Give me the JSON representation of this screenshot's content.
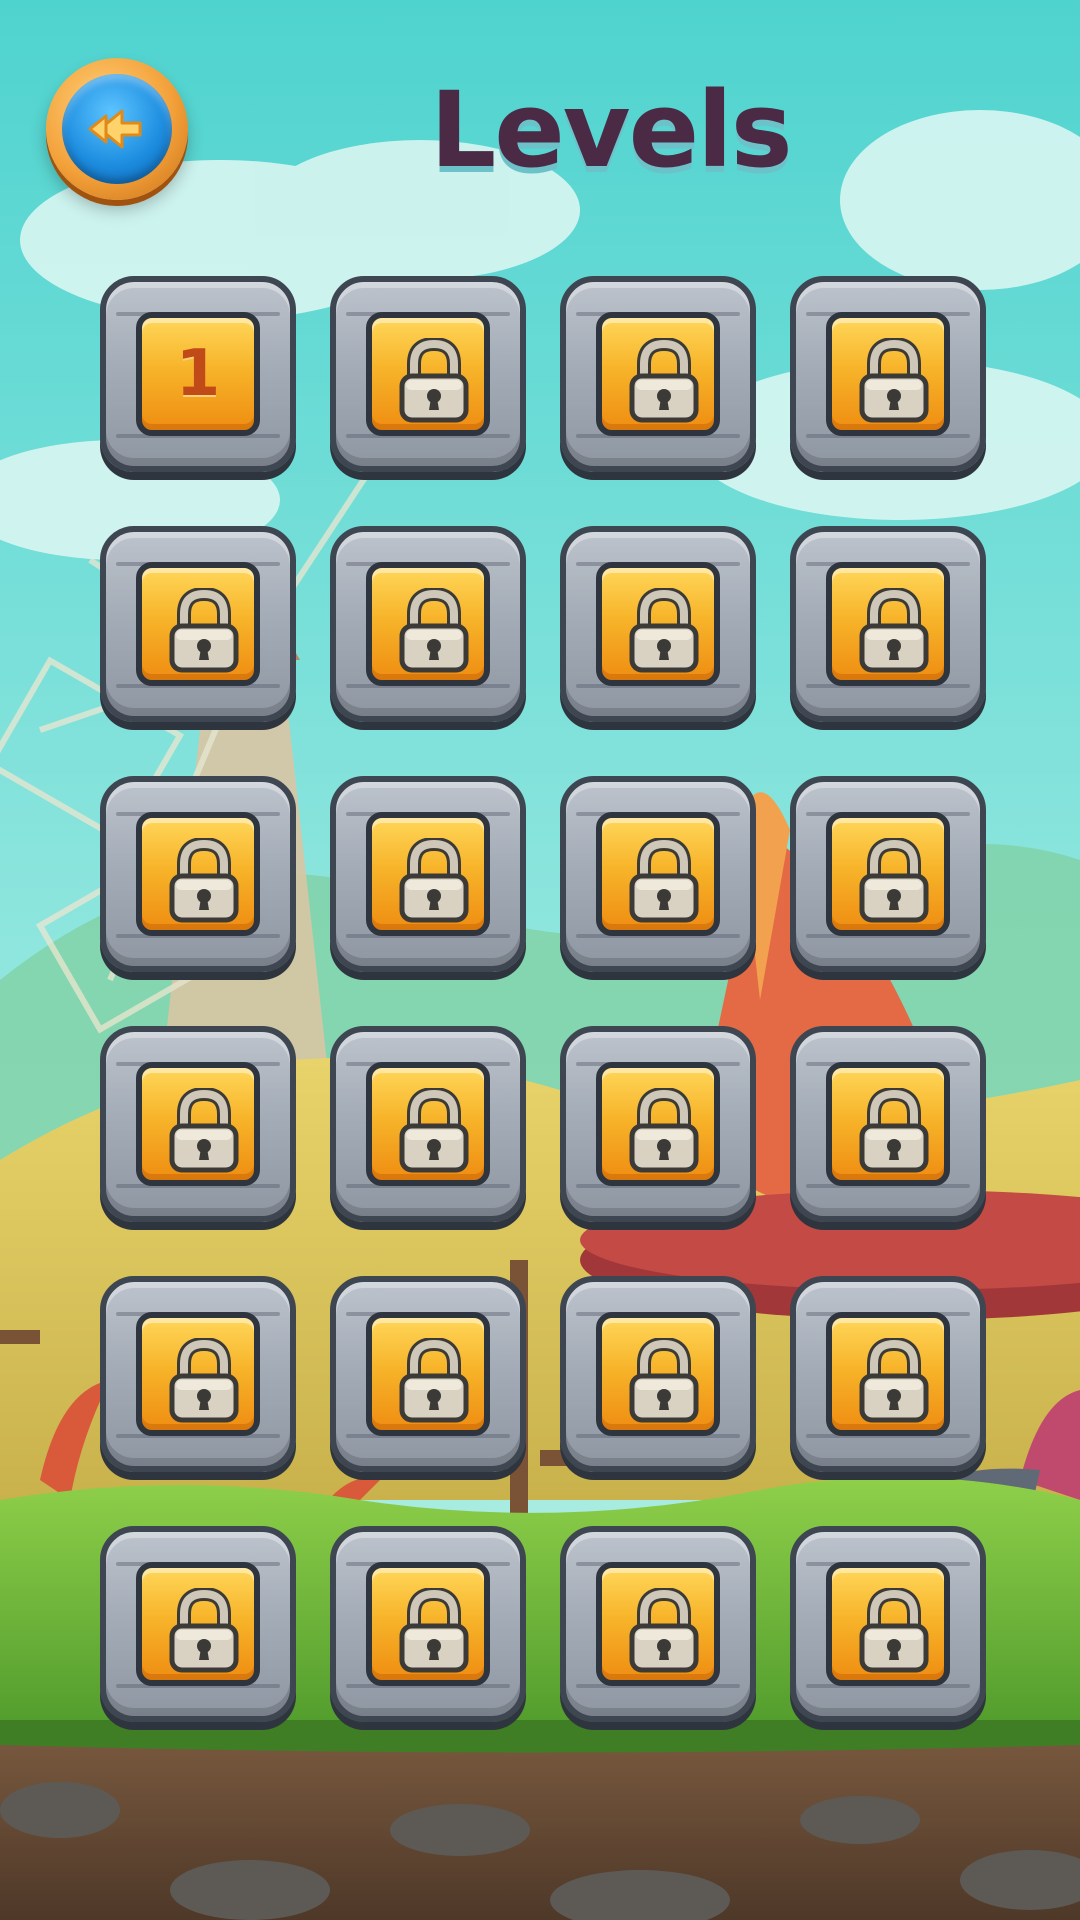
{
  "header": {
    "title": "Levels",
    "back_button_icon": "back-arrow-icon"
  },
  "levels": [
    {
      "number": "1",
      "status": "unlocked"
    },
    {
      "status": "locked"
    },
    {
      "status": "locked"
    },
    {
      "status": "locked"
    },
    {
      "status": "locked"
    },
    {
      "status": "locked"
    },
    {
      "status": "locked"
    },
    {
      "status": "locked"
    },
    {
      "status": "locked"
    },
    {
      "status": "locked"
    },
    {
      "status": "locked"
    },
    {
      "status": "locked"
    },
    {
      "status": "locked"
    },
    {
      "status": "locked"
    },
    {
      "status": "locked"
    },
    {
      "status": "locked"
    },
    {
      "status": "locked"
    },
    {
      "status": "locked"
    },
    {
      "status": "locked"
    },
    {
      "status": "locked"
    },
    {
      "status": "locked"
    },
    {
      "status": "locked"
    },
    {
      "status": "locked"
    },
    {
      "status": "locked"
    }
  ],
  "colors": {
    "sky": "#5fd6d0",
    "title": "#4b2a46",
    "tile_gold": "#f7b42a",
    "stone": "#a4acb7",
    "button_blue": "#1e8ee0",
    "button_orange": "#f3a13a"
  },
  "lock_icon": "padlock-icon"
}
